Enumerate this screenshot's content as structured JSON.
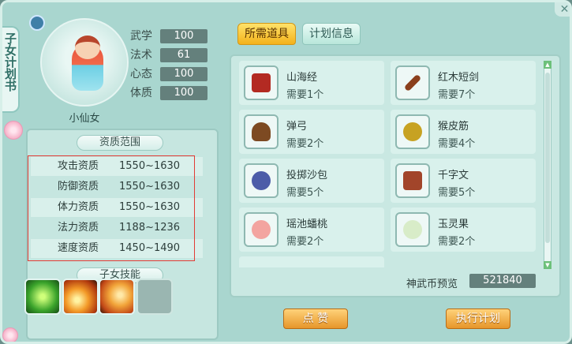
{
  "sidebar": {
    "title": "子女计划书"
  },
  "character": {
    "name": "小仙女",
    "stats": [
      {
        "label": "武学",
        "value": "100"
      },
      {
        "label": "法术",
        "value": "61"
      },
      {
        "label": "心态",
        "value": "100"
      },
      {
        "label": "体质",
        "value": "100"
      }
    ]
  },
  "aptitude": {
    "title": "资质范围",
    "rows": [
      {
        "label": "攻击资质",
        "value": "1550~1630"
      },
      {
        "label": "防御资质",
        "value": "1550~1630"
      },
      {
        "label": "体力资质",
        "value": "1550~1630"
      },
      {
        "label": "法力资质",
        "value": "1188~1236"
      },
      {
        "label": "速度资质",
        "value": "1450~1490"
      }
    ]
  },
  "skills": {
    "title": "子女技能"
  },
  "tabs": [
    {
      "label": "所需道具",
      "active": true
    },
    {
      "label": "计划信息",
      "active": false
    }
  ],
  "items": [
    {
      "name": "山海经",
      "need": "需要1个",
      "icon": "book-icon"
    },
    {
      "name": "红木短剑",
      "need": "需要7个",
      "icon": "wooden-sword-icon"
    },
    {
      "name": "弹弓",
      "need": "需要2个",
      "icon": "slingshot-icon"
    },
    {
      "name": "猴皮筋",
      "need": "需要4个",
      "icon": "rubber-band-icon"
    },
    {
      "name": "投掷沙包",
      "need": "需要5个",
      "icon": "sandbag-icon"
    },
    {
      "name": "千字文",
      "need": "需要5个",
      "icon": "scroll-book-icon"
    },
    {
      "name": "瑶池蟠桃",
      "need": "需要2个",
      "icon": "peach-icon"
    },
    {
      "name": "玉灵果",
      "need": "需要2个",
      "icon": "jade-fruit-icon"
    }
  ],
  "preview": {
    "label": "神武币预览",
    "value": "521840"
  },
  "buttons": {
    "like": "点 赞",
    "execute": "执行计划"
  },
  "colors": {
    "accent": "#f3b21a",
    "highlight_box": "#e23b35",
    "value_box": "#64807c"
  }
}
